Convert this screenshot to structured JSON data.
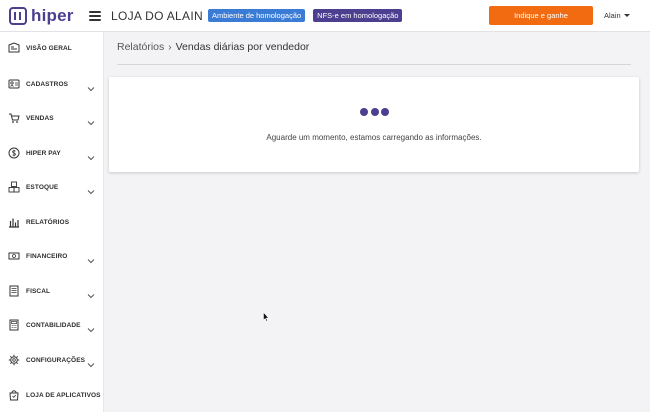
{
  "header": {
    "logo_text": "hiper",
    "store_name": "LOJA DO ALAIN",
    "badge_env": "Ambiente de homologação",
    "badge_nfse": "NFS-e em homologação",
    "cta_label": "Indique e ganhe",
    "user_name": "Alain"
  },
  "sidebar": {
    "items": [
      {
        "label": "VISÃO GERAL",
        "icon": "dashboard-icon",
        "expandable": false
      },
      {
        "label": "CADASTROS",
        "icon": "id-card-icon",
        "expandable": true
      },
      {
        "label": "VENDAS",
        "icon": "cart-icon",
        "expandable": true
      },
      {
        "label": "HIPER PAY",
        "icon": "dollar-icon",
        "expandable": true
      },
      {
        "label": "ESTOQUE",
        "icon": "boxes-icon",
        "expandable": true
      },
      {
        "label": "RELATÓRIOS",
        "icon": "bar-chart-icon",
        "expandable": false
      },
      {
        "label": "FINANCEIRO",
        "icon": "money-icon",
        "expandable": true
      },
      {
        "label": "FISCAL",
        "icon": "document-icon",
        "expandable": true
      },
      {
        "label": "CONTABILIDADE",
        "icon": "calculator-icon",
        "expandable": true
      },
      {
        "label": "CONFIGURAÇÕES",
        "icon": "gear-icon",
        "expandable": true
      },
      {
        "label": "LOJA DE APLICATIVOS",
        "icon": "shopping-bag-icon",
        "expandable": false
      }
    ]
  },
  "main": {
    "breadcrumb_parent": "Relatórios",
    "breadcrumb_separator": "›",
    "breadcrumb_current": "Vendas diárias por vendedor",
    "loading_text": "Aguarde um momento, estamos carregando as informações."
  },
  "colors": {
    "brand": "#4d3f8f",
    "accent": "#f26b10",
    "badge_blue": "#3a7bd5"
  }
}
